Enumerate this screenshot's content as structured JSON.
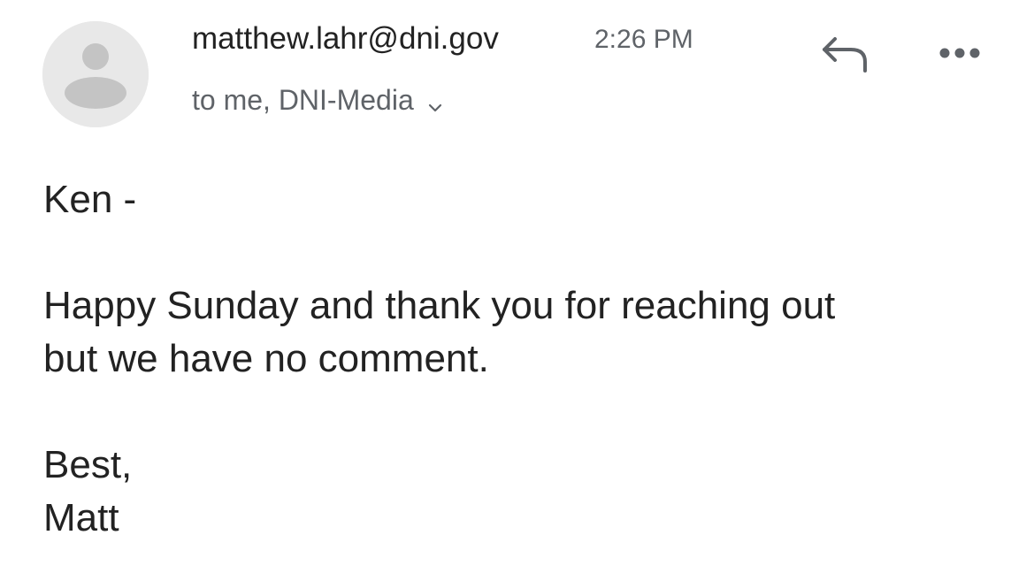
{
  "email": {
    "sender": "matthew.lahr@dni.gov",
    "time": "2:26 PM",
    "recipients": "to me, DNI-Media",
    "icons": {
      "avatar": "person-icon",
      "reply": "reply-icon",
      "more": "more-horizontal-icon",
      "recipients_toggle": "chevron-down-icon"
    },
    "body": {
      "greeting": "Ken -",
      "line1": "Happy Sunday and thank you for reaching out",
      "line2": "but we have no comment.",
      "closing": "Best,",
      "signature": "Matt"
    }
  }
}
